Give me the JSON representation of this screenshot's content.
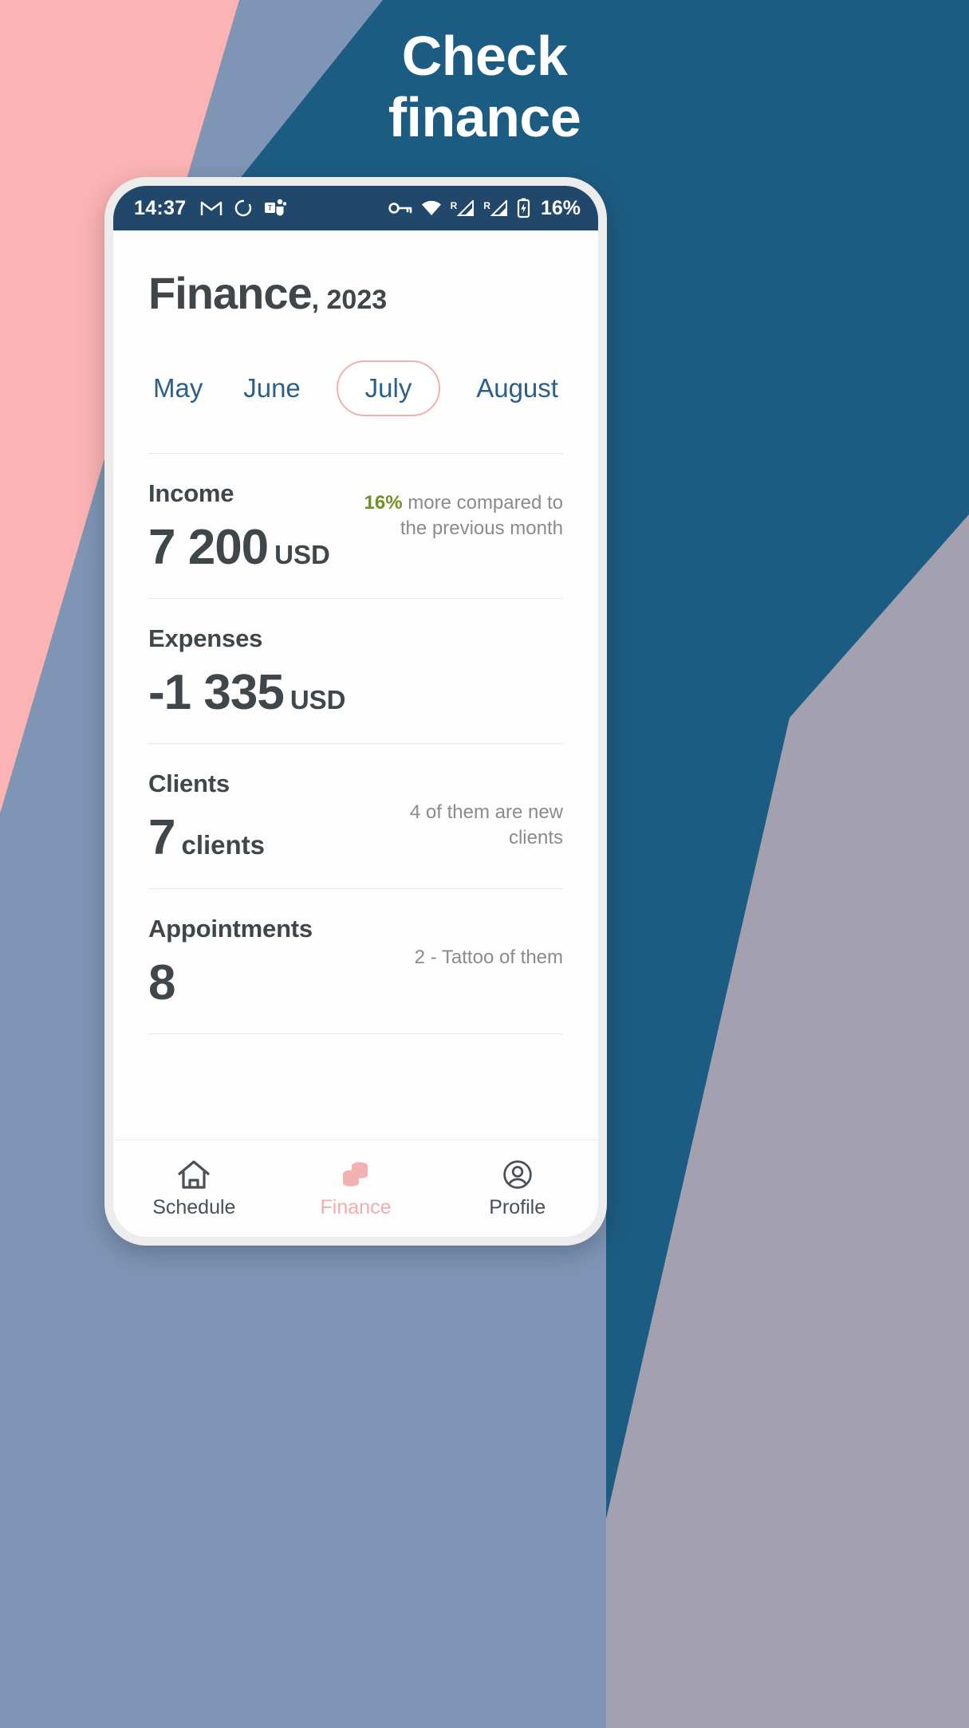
{
  "hero": {
    "line1": "Check",
    "line2": "finance"
  },
  "colors": {
    "backdrop_blue": "#1d5c82",
    "backdrop_pink": "#fbb3b3",
    "backdrop_slate": "#7e95b5",
    "backdrop_mauve": "#a3a1b0",
    "accent_pink": "#eeb0b2",
    "month_blue": "#2d5f87",
    "text_dark": "#3f474b",
    "note_gray": "#8b8b8f",
    "positive_green": "#6f9127",
    "statusbar_navy": "#21486b"
  },
  "statusbar": {
    "time": "14:37",
    "left_icons": [
      "gmail-icon",
      "sync-icon",
      "teams-icon"
    ],
    "right_icons": [
      "vpn-key-icon",
      "wifi-icon",
      "signal-roaming-1-icon",
      "signal-roaming-2-icon",
      "battery-charging-icon"
    ],
    "battery": "16%"
  },
  "header": {
    "title": "Finance",
    "year": ", 2023"
  },
  "months": {
    "items": [
      {
        "label": "May",
        "active": false
      },
      {
        "label": "June",
        "active": false
      },
      {
        "label": "July",
        "active": true
      },
      {
        "label": "August",
        "active": false
      }
    ]
  },
  "metrics": [
    {
      "label": "Income",
      "number": "7 200",
      "unit": "USD",
      "note_highlight": "16%",
      "note_rest": " more compared to the previous month"
    },
    {
      "label": "Expenses",
      "number": "-1 335",
      "unit": "USD",
      "note_highlight": "",
      "note_rest": ""
    },
    {
      "label": "Clients",
      "number": "7",
      "unit": "clients",
      "note_highlight": "",
      "note_rest": "4 of them are new clients"
    },
    {
      "label": "Appointments",
      "number": "8",
      "unit": "",
      "note_highlight": "",
      "note_rest": "2 - Tattoo of them"
    }
  ],
  "bottom_nav": {
    "items": [
      {
        "label": "Schedule",
        "icon": "home-icon",
        "active": false
      },
      {
        "label": "Finance",
        "icon": "coins-icon",
        "active": true
      },
      {
        "label": "Profile",
        "icon": "account-circle-icon",
        "active": false
      }
    ]
  }
}
